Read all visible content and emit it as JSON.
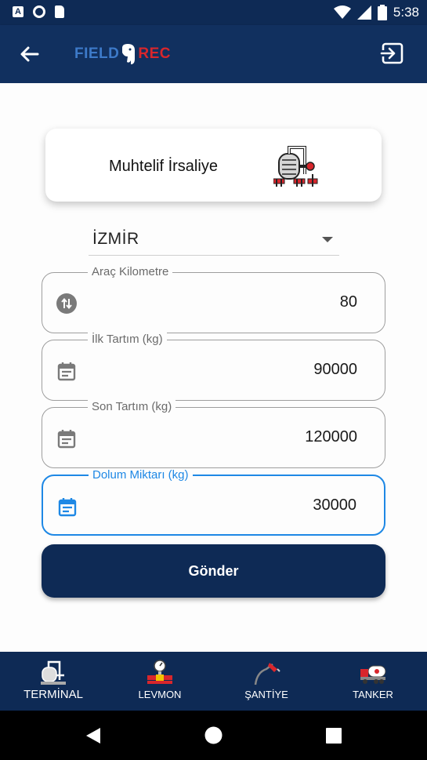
{
  "status_bar": {
    "time": "5:38",
    "notification_icons": [
      "a-icon",
      "circle-icon",
      "sd-card-icon"
    ]
  },
  "app_bar": {
    "logo_left": "FIELD",
    "logo_right": "REC",
    "back_icon": "arrow-left-icon",
    "exit_icon": "exit-icon"
  },
  "header_card": {
    "title": "Muhtelif İrsaliye",
    "icon": "tank-icon"
  },
  "location_dropdown": {
    "selected": "İZMİR"
  },
  "fields": [
    {
      "label": "Araç Kilometre",
      "value": "80",
      "icon": "swap-vertical-icon"
    },
    {
      "label": "İlk Tartım (kg)",
      "value": "90000",
      "icon": "calendar-icon"
    },
    {
      "label": "Son Tartım (kg)",
      "value": "120000",
      "icon": "calendar-icon"
    },
    {
      "label": "Dolum Miktarı (kg)",
      "value": "30000",
      "icon": "calendar-icon",
      "focused": true
    }
  ],
  "submit_label": "Gönder",
  "bottom_nav": [
    {
      "label": "TERMİNAL",
      "active": true
    },
    {
      "label": "LEVMON",
      "active": false
    },
    {
      "label": "ŞANTİYE",
      "active": false
    },
    {
      "label": "TANKER",
      "active": false
    }
  ],
  "colors": {
    "primary": "#0e2a55",
    "focus": "#1e88e5",
    "logo_blue": "#3d7ac9",
    "logo_red": "#d8262c"
  }
}
